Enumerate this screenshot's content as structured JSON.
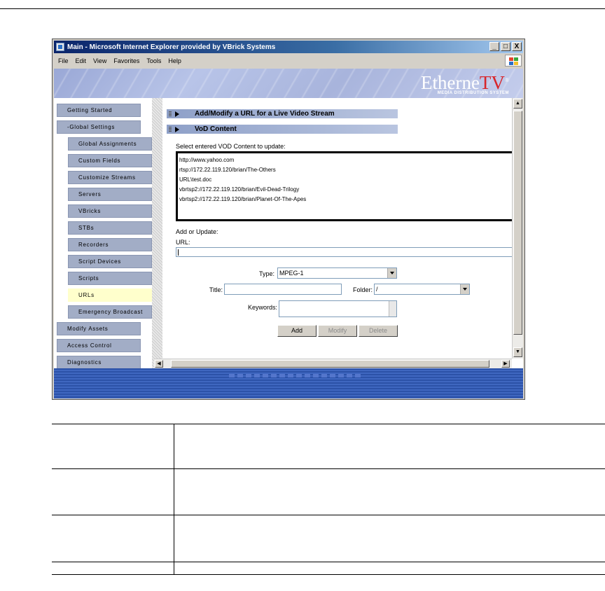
{
  "window": {
    "title": "Main - Microsoft Internet Explorer provided by VBrick Systems",
    "controls": [
      "_",
      "□",
      "X"
    ]
  },
  "menu": {
    "items": [
      "File",
      "Edit",
      "View",
      "Favorites",
      "Tools",
      "Help"
    ]
  },
  "banner": {
    "brand_main": "Etherne",
    "brand_tv": "TV",
    "brand_reg": "®",
    "brand_sub": "MEDIA DISTRIBUTION SYSTEM",
    "brand_color": "#d8252a"
  },
  "nav": {
    "items": [
      {
        "label": "Getting Started"
      },
      {
        "label": "-Global Settings"
      },
      {
        "label": "Global Assignments"
      },
      {
        "label": "Custom Fields"
      },
      {
        "label": "Customize Streams"
      },
      {
        "label": "Servers"
      },
      {
        "label": "VBricks"
      },
      {
        "label": "STBs"
      },
      {
        "label": "Recorders"
      },
      {
        "label": "Script Devices"
      },
      {
        "label": "Scripts"
      },
      {
        "label": "URLs"
      },
      {
        "label": "Emergency Broadcast"
      },
      {
        "label": "Modify Assets"
      },
      {
        "label": "Access Control"
      },
      {
        "label": "Diagnostics"
      }
    ],
    "active": "URLs"
  },
  "content": {
    "section1": "Add/Modify a URL for a Live Video Stream",
    "section2": "VoD Content",
    "select_prompt": "Select entered VOD Content to update:",
    "vod_list": [
      "http://www.yahoo.com",
      "rtsp://172.22.119.120/brian/The-Others",
      "URL\\test.doc",
      "vbrtsp2://172.22.119.120/brian/Evil-Dead-Trilogy",
      "vbrtsp2://172.22.119.120/brian/Planet-Of-The-Apes"
    ],
    "add_or_update": "Add or Update:",
    "url_label": "URL:",
    "url_value": "",
    "type_label": "Type:",
    "type_value": "MPEG-1",
    "title_label": "Title:",
    "title_value": "",
    "folder_label": "Folder:",
    "folder_value": "/",
    "keywords_label": "Keywords:",
    "keywords_value": "",
    "buttons": {
      "add": "Add",
      "modify": "Modify",
      "delete": "Delete"
    }
  }
}
